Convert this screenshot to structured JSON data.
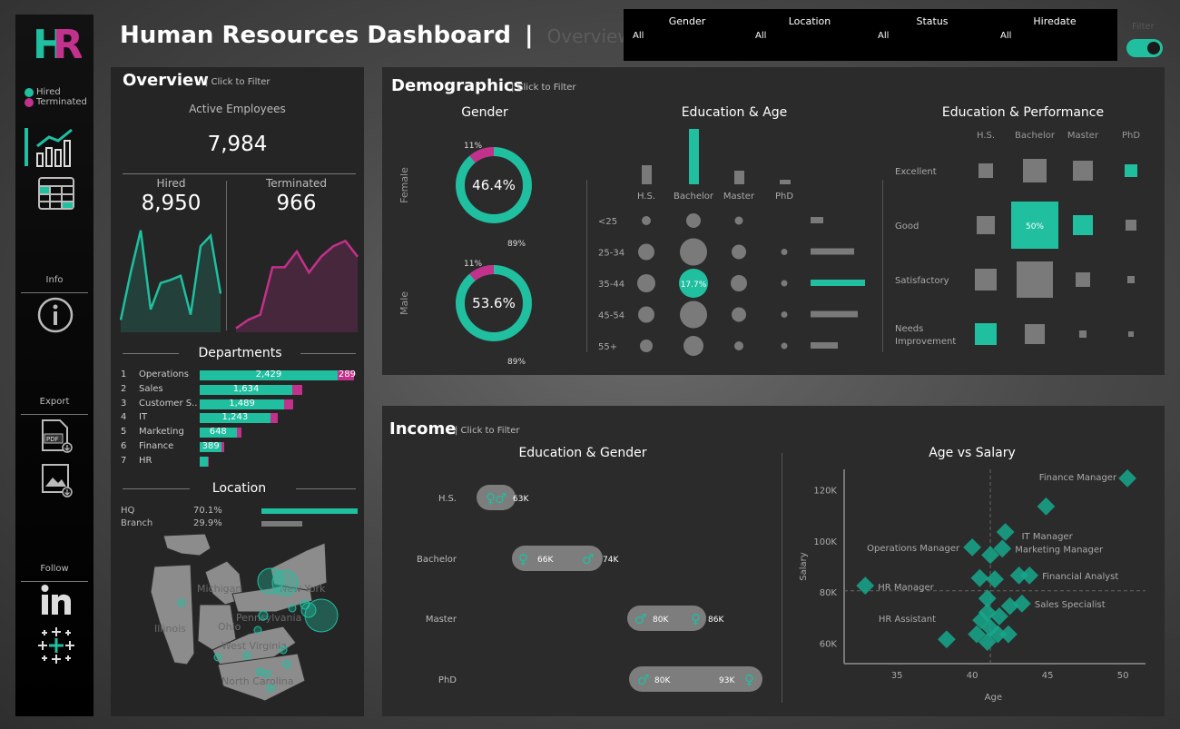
{
  "colors": {
    "teal": "#1fbfa0",
    "magenta": "#c2318b",
    "grey": "#7a7a7a",
    "panel": "#2b2b2b"
  },
  "header": {
    "logo": "HR",
    "title": "Human Resources Dashboard",
    "separator": "|",
    "subtitle": "Overview"
  },
  "filters": [
    {
      "label": "Gender",
      "value": "All"
    },
    {
      "label": "Location",
      "value": "All"
    },
    {
      "label": "Status",
      "value": "All"
    },
    {
      "label": "Hiredate",
      "value": "All"
    }
  ],
  "filter_toggle": {
    "label": "Filter",
    "on": true
  },
  "sidebar": {
    "legend": [
      {
        "label": "Hired",
        "color": "#1fbfa0"
      },
      {
        "label": "Terminated",
        "color": "#c2318b"
      }
    ],
    "info_label": "Info",
    "export_label": "Export",
    "follow_label": "Follow",
    "icons": [
      "chart-icon",
      "table-icon",
      "info-icon",
      "pdf-export-icon",
      "image-export-icon",
      "linkedin-icon",
      "tableau-icon"
    ]
  },
  "overview": {
    "title": "Overview",
    "hint": "| Click to Filter",
    "active_label": "Active Employees",
    "active_value": "7,984",
    "hired_label": "Hired",
    "hired_value": "8,950",
    "terminated_label": "Terminated",
    "terminated_value": "966",
    "departments_title": "Departments",
    "departments": [
      {
        "rank": "1",
        "name": "Operations",
        "hired": 2429,
        "hired_label": "2,429",
        "term": 289,
        "term_label": "289"
      },
      {
        "rank": "2",
        "name": "Sales",
        "hired": 1634,
        "hired_label": "1,634",
        "term": 180,
        "term_label": ""
      },
      {
        "rank": "3",
        "name": "Customer S..",
        "hired": 1489,
        "hired_label": "1,489",
        "term": 160,
        "term_label": ""
      },
      {
        "rank": "4",
        "name": "IT",
        "hired": 1243,
        "hired_label": "1,243",
        "term": 130,
        "term_label": ""
      },
      {
        "rank": "5",
        "name": "Marketing",
        "hired": 648,
        "hired_label": "648",
        "term": 90,
        "term_label": ""
      },
      {
        "rank": "6",
        "name": "Finance",
        "hired": 389,
        "hired_label": "389",
        "term": 50,
        "term_label": ""
      },
      {
        "rank": "7",
        "name": "HR",
        "hired": 150,
        "hired_label": "",
        "term": 10,
        "term_label": ""
      }
    ],
    "location_title": "Location",
    "locations": [
      {
        "name": "HQ",
        "pct": "70.1%",
        "value": 70.1
      },
      {
        "name": "Branch",
        "pct": "29.9%",
        "value": 29.9
      }
    ],
    "map_labels": [
      "Michigan",
      "New York",
      "Illinois",
      "Ohio",
      "Pennsylvania",
      "West Virginia",
      "North Carolina"
    ]
  },
  "demographics": {
    "title": "Demographics",
    "hint": "| Click to Filter",
    "gender_title": "Gender",
    "gender": [
      {
        "name": "Female",
        "center": "46.4%",
        "minor": "11%",
        "major": "89%",
        "share": 11
      },
      {
        "name": "Male",
        "center": "53.6%",
        "minor": "11%",
        "major": "89%",
        "share": 11
      }
    ],
    "edu_age_title": "Education & Age",
    "education_levels": [
      "H.S.",
      "Bachelor",
      "Master",
      "PhD"
    ],
    "age_groups": [
      "<25",
      "25-34",
      "35-44",
      "45-54",
      "55+"
    ],
    "highlight_label": "17.7%",
    "edu_perf_title": "Education & Performance",
    "performance": [
      "Excellent",
      "Good",
      "Satisfactory",
      "Needs Improvement"
    ],
    "perf_highlight": "50%"
  },
  "income": {
    "title": "Income",
    "hint": "| Click to Filter",
    "edu_gender_title": "Education & Gender",
    "rows": [
      {
        "edu": "H.S.",
        "left_label": "",
        "right_label": "63K"
      },
      {
        "edu": "Bachelor",
        "left_label": "66K",
        "right_label": "74K"
      },
      {
        "edu": "Master",
        "left_label": "80K",
        "right_label": "86K"
      },
      {
        "edu": "PhD",
        "left_label": "80K",
        "right_label": "93K"
      }
    ],
    "age_salary_title": "Age vs Salary",
    "ylabel": "Salary",
    "xlabel": "Age"
  },
  "chart_data": [
    {
      "type": "line",
      "title": "Hired",
      "series": [
        {
          "name": "Hired",
          "values": [
            10,
            55,
            95,
            20,
            45,
            48,
            52,
            15,
            80,
            90,
            35
          ]
        }
      ]
    },
    {
      "type": "line",
      "title": "Terminated",
      "series": [
        {
          "name": "Terminated",
          "values": [
            2,
            10,
            15,
            60,
            60,
            75,
            55,
            70,
            80,
            85,
            70
          ]
        }
      ]
    },
    {
      "type": "scatter",
      "title": "Age vs Salary",
      "xlabel": "Age",
      "ylabel": "Salary",
      "xlim": [
        31.5,
        51.5
      ],
      "ylim": [
        52000,
        128000
      ],
      "x_ticks": [
        "35",
        "40",
        "45",
        "50"
      ],
      "y_ticks": [
        "60K",
        "80K",
        "100K",
        "120K"
      ],
      "points": [
        {
          "x": 50.3,
          "y": 124500,
          "label": "Finance Manager"
        },
        {
          "x": 44.9,
          "y": 113500,
          "label": ""
        },
        {
          "x": 42.2,
          "y": 103500,
          "label": "IT Manager"
        },
        {
          "x": 40,
          "y": 97500,
          "label": "Operations Manager"
        },
        {
          "x": 41.2,
          "y": 94500,
          "label": ""
        },
        {
          "x": 42,
          "y": 97000,
          "label": "Marketing Manager"
        },
        {
          "x": 43.1,
          "y": 86500,
          "label": ""
        },
        {
          "x": 43.8,
          "y": 86500,
          "label": "Financial Analyst"
        },
        {
          "x": 32.9,
          "y": 82500,
          "label": "HR Manager"
        },
        {
          "x": 40.5,
          "y": 85500,
          "label": ""
        },
        {
          "x": 41.5,
          "y": 85000,
          "label": ""
        },
        {
          "x": 41,
          "y": 77500,
          "label": ""
        },
        {
          "x": 42.5,
          "y": 74500,
          "label": ""
        },
        {
          "x": 43.3,
          "y": 75500,
          "label": "Sales Specialist"
        },
        {
          "x": 41,
          "y": 72000,
          "label": ""
        },
        {
          "x": 41.8,
          "y": 70500,
          "label": ""
        },
        {
          "x": 40.6,
          "y": 69000,
          "label": "HR Assistant"
        },
        {
          "x": 41.2,
          "y": 66000,
          "label": ""
        },
        {
          "x": 40.3,
          "y": 63500,
          "label": ""
        },
        {
          "x": 41.7,
          "y": 63500,
          "label": ""
        },
        {
          "x": 42.4,
          "y": 63500,
          "label": ""
        },
        {
          "x": 38.3,
          "y": 61500,
          "label": ""
        },
        {
          "x": 41,
          "y": 60500,
          "label": ""
        }
      ]
    }
  ]
}
